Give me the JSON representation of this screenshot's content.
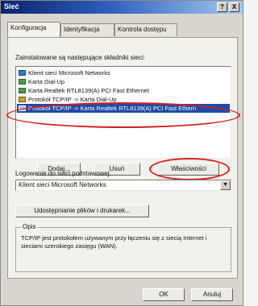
{
  "window": {
    "title": "Sieć",
    "help_button": "?",
    "close_button": "X"
  },
  "tabs": [
    "Konfiguracja",
    "Identyfikacja",
    "Kontrola dostępu"
  ],
  "components_label": "Zainstalowane są następujące składniki sieci:",
  "components": [
    {
      "label": "Klient sieci Microsoft Networks",
      "icon": "network-client-icon"
    },
    {
      "label": "Karta Dial-Up",
      "icon": "adapter-icon"
    },
    {
      "label": "Karta Realtek RTL8139(A) PCI Fast Ethernet",
      "icon": "adapter-icon"
    },
    {
      "label": "Protokół TCP/IP -> Karta Dial-Up",
      "icon": "protocol-icon"
    },
    {
      "label": "Protokół TCP/IP -> Karta Realtek RTL8139(A) PCI Fast Ethern",
      "icon": "protocol-icon"
    }
  ],
  "selected_component_index": 4,
  "buttons": {
    "add": "Dodaj...",
    "remove": "Usuń",
    "properties": "Właściwości",
    "file_print_sharing": "Udostępnianie plików i drukarek...",
    "ok": "OK",
    "cancel": "Anuluj"
  },
  "primary_logon_label": "Logowanie do sieci podstawowej:",
  "primary_logon_value": "Klient sieci Microsoft Networks",
  "description": {
    "title": "Opis",
    "text": "TCP/IP jest protokołem używanym przy łączeniu się z siecią Internet i sieciami szerokiego zasięgu (WAN)."
  },
  "annotation_color": "#d61f1f"
}
